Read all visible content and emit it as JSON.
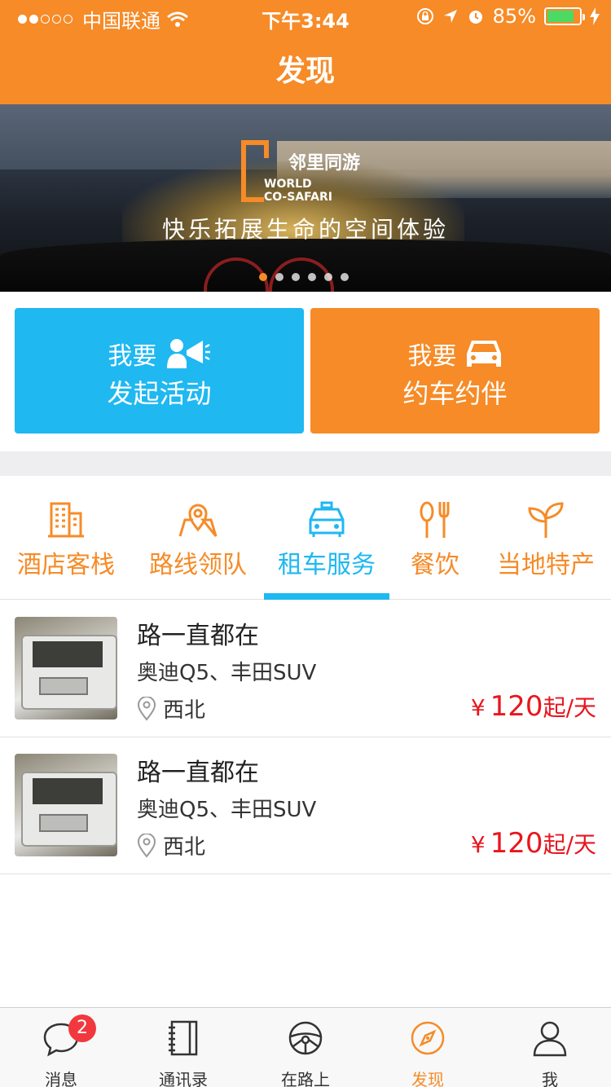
{
  "status_bar": {
    "carrier": "中国联通",
    "time": "下午3:44",
    "battery": "85%",
    "battery_level": 0.85
  },
  "nav": {
    "title": "发现"
  },
  "banner": {
    "logo_cn": "邻里同游",
    "logo_en_line1": "WORLD",
    "logo_en_line2": "CO-SAFARI",
    "slogan": "快乐拓展生命的空间体验",
    "page_count": 6,
    "active_page": 0
  },
  "actions": {
    "launch": {
      "line1": "我要",
      "line2": "发起活动",
      "icon": "megaphone-person-icon"
    },
    "carpool": {
      "line1": "我要",
      "line2": "约车约伴",
      "icon": "car-icon"
    }
  },
  "categories": [
    {
      "label": "酒店客栈",
      "icon": "building-icon",
      "active": false
    },
    {
      "label": "路线领队",
      "icon": "map-pin-icon",
      "active": false
    },
    {
      "label": "租车服务",
      "icon": "taxi-icon",
      "active": true
    },
    {
      "label": "餐饮",
      "icon": "fork-spoon-icon",
      "active": false
    },
    {
      "label": "当地特产",
      "icon": "sprout-icon",
      "active": false
    }
  ],
  "listings": [
    {
      "title": "路一直都在",
      "subtitle": "奥迪Q5、丰田SUV",
      "location": "西北",
      "currency": "¥",
      "price": "120",
      "unit": "起/天"
    },
    {
      "title": "路一直都在",
      "subtitle": "奥迪Q5、丰田SUV",
      "location": "西北",
      "currency": "¥",
      "price": "120",
      "unit": "起/天"
    }
  ],
  "tabbar": [
    {
      "label": "消息",
      "icon": "chat-bubble-icon",
      "badge": "2",
      "active": false
    },
    {
      "label": "通讯录",
      "icon": "address-book-icon",
      "active": false
    },
    {
      "label": "在路上",
      "icon": "steering-wheel-icon",
      "active": false
    },
    {
      "label": "发现",
      "icon": "compass-icon",
      "active": true
    },
    {
      "label": "我",
      "icon": "person-icon",
      "active": false
    }
  ],
  "colors": {
    "brand_orange": "#f68b27",
    "accent_blue": "#1fb8f1",
    "price_red": "#e8161f",
    "badge_red": "#f2383f"
  }
}
